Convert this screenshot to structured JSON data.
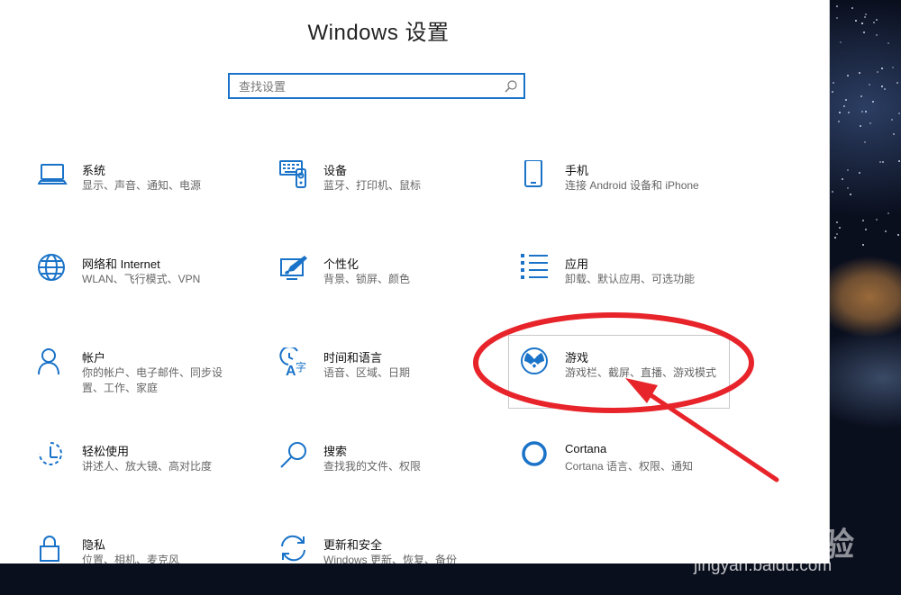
{
  "window": {
    "title": "Windows 设置"
  },
  "search": {
    "placeholder": "查找设置"
  },
  "tiles": [
    {
      "title": "系统",
      "desc": "显示、声音、通知、电源",
      "icon": "laptop-icon"
    },
    {
      "title": "设备",
      "desc": "蓝牙、打印机、鼠标",
      "icon": "devices-icon"
    },
    {
      "title": "手机",
      "desc": "连接 Android 设备和 iPhone",
      "icon": "phone-icon"
    },
    {
      "title": "网络和 Internet",
      "desc": "WLAN、飞行模式、VPN",
      "icon": "globe-icon"
    },
    {
      "title": "个性化",
      "desc": "背景、锁屏、颜色",
      "icon": "personalization-icon"
    },
    {
      "title": "应用",
      "desc": "卸载、默认应用、可选功能",
      "icon": "apps-list-icon"
    },
    {
      "title": "帐户",
      "desc": "你的帐户、电子邮件、同步设置、工作、家庭",
      "icon": "person-icon"
    },
    {
      "title": "时间和语言",
      "desc": "语音、区域、日期",
      "icon": "time-language-icon"
    },
    {
      "title": "游戏",
      "desc": "游戏栏、截屏、直播、游戏模式",
      "icon": "xbox-icon"
    },
    {
      "title": "轻松使用",
      "desc": "讲述人、放大镜、高对比度",
      "icon": "ease-of-access-icon"
    },
    {
      "title": "搜索",
      "desc": "查找我的文件、权限",
      "icon": "search-icon"
    },
    {
      "title": "Cortana",
      "desc": "Cortana 语言、权限、通知",
      "icon": "cortana-icon"
    },
    {
      "title": "隐私",
      "desc": "位置、相机、麦克风",
      "icon": "lock-icon"
    },
    {
      "title": "更新和安全",
      "desc": "Windows 更新、恢复、备份",
      "icon": "update-icon"
    }
  ],
  "watermark": {
    "logo": "Baidu经验",
    "url": "jingyan.baidu.com"
  },
  "colors": {
    "accent": "#1a73c8",
    "annotation": "#e8242b"
  }
}
